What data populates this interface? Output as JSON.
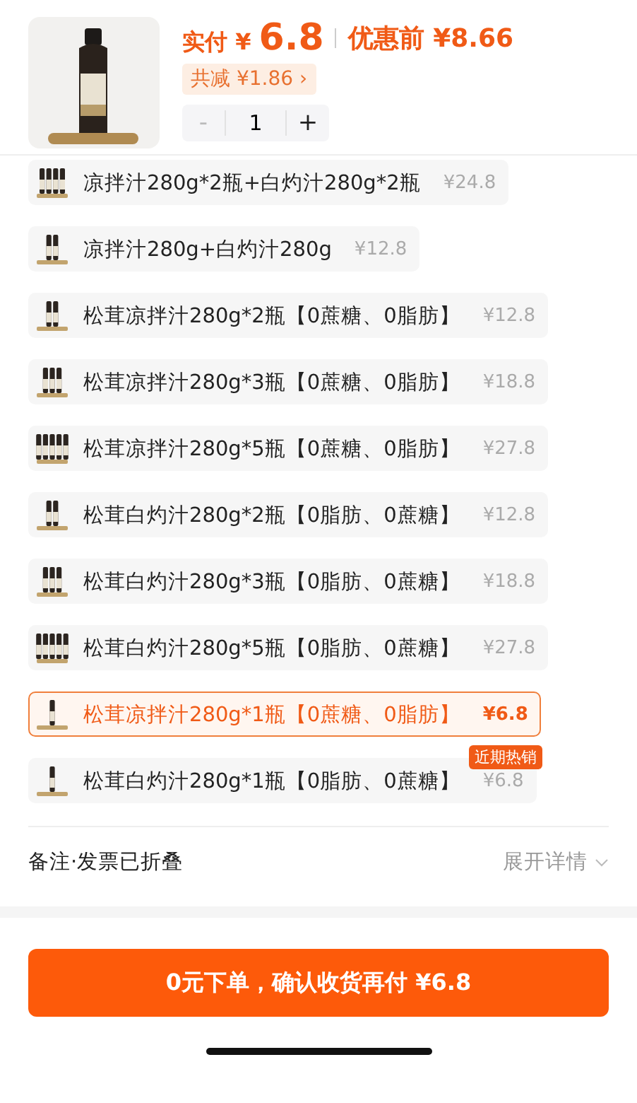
{
  "product": {
    "paid_label": "实付",
    "paid_currency": "¥",
    "paid_amount": "6.8",
    "original_label": "优惠前",
    "original_price": "¥8.66",
    "discount": "共减 ¥1.86",
    "discount_arrow": "›",
    "quantity": {
      "minus": "-",
      "value": "1",
      "plus": "+",
      "minus_disabled": true
    }
  },
  "options": [
    {
      "label": "凉拌汁280g*2瓶+白灼汁280g*2瓶",
      "price": "¥24.8",
      "selected": false
    },
    {
      "label": "凉拌汁280g+白灼汁280g",
      "price": "¥12.8",
      "selected": false
    },
    {
      "label": "松茸凉拌汁280g*2瓶【0蔗糖、0脂肪】",
      "price": "¥12.8",
      "selected": false
    },
    {
      "label": "松茸凉拌汁280g*3瓶【0蔗糖、0脂肪】",
      "price": "¥18.8",
      "selected": false
    },
    {
      "label": "松茸凉拌汁280g*5瓶【0蔗糖、0脂肪】",
      "price": "¥27.8",
      "selected": false
    },
    {
      "label": "松茸白灼汁280g*2瓶【0脂肪、0蔗糖】",
      "price": "¥12.8",
      "selected": false
    },
    {
      "label": "松茸白灼汁280g*3瓶【0脂肪、0蔗糖】",
      "price": "¥18.8",
      "selected": false
    },
    {
      "label": "松茸白灼汁280g*5瓶【0脂肪、0蔗糖】",
      "price": "¥27.8",
      "selected": false
    },
    {
      "label": "松茸凉拌汁280g*1瓶【0蔗糖、0脂肪】",
      "price": "¥6.8",
      "selected": true
    },
    {
      "label": "松茸白灼汁280g*1瓶【0脂肪、0蔗糖】",
      "price": "¥6.8",
      "selected": false,
      "badge": "近期热销"
    }
  ],
  "remarks": {
    "label": "备注·发票已折叠",
    "action": "展开详情"
  },
  "submit_button": "0元下单，确认收货再付 ¥6.8"
}
